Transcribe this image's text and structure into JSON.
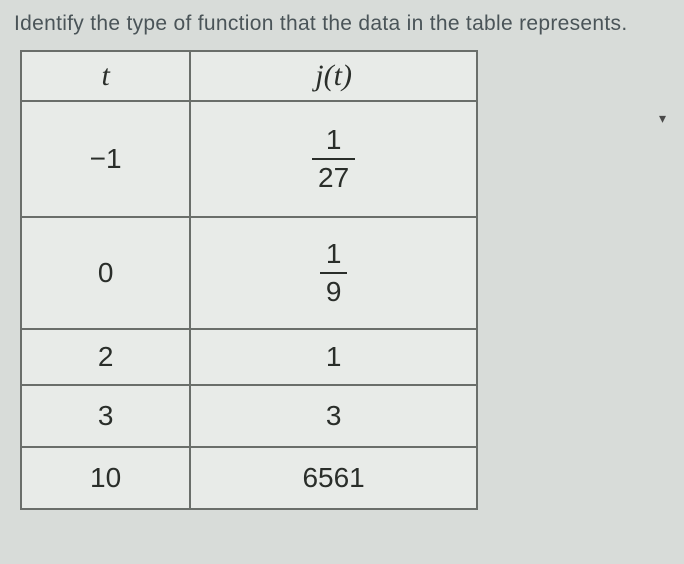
{
  "question": "Identify the type of function that the data in the table represents.",
  "headers": {
    "col1": "t",
    "col2": "j(t)"
  },
  "rows": [
    {
      "t": "−1",
      "jt": {
        "type": "fraction",
        "num": "1",
        "den": "27"
      }
    },
    {
      "t": "0",
      "jt": {
        "type": "fraction",
        "num": "1",
        "den": "9"
      }
    },
    {
      "t": "2",
      "jt": {
        "type": "text",
        "value": "1"
      }
    },
    {
      "t": "3",
      "jt": {
        "type": "text",
        "value": "3"
      }
    },
    {
      "t": "10",
      "jt": {
        "type": "text",
        "value": "6561"
      }
    }
  ],
  "chart_data": {
    "type": "table",
    "title": "",
    "columns": [
      "t",
      "j(t)"
    ],
    "rows": [
      [
        "-1",
        "1/27"
      ],
      [
        "0",
        "1/9"
      ],
      [
        "2",
        "1"
      ],
      [
        "3",
        "3"
      ],
      [
        "10",
        "6561"
      ]
    ]
  }
}
